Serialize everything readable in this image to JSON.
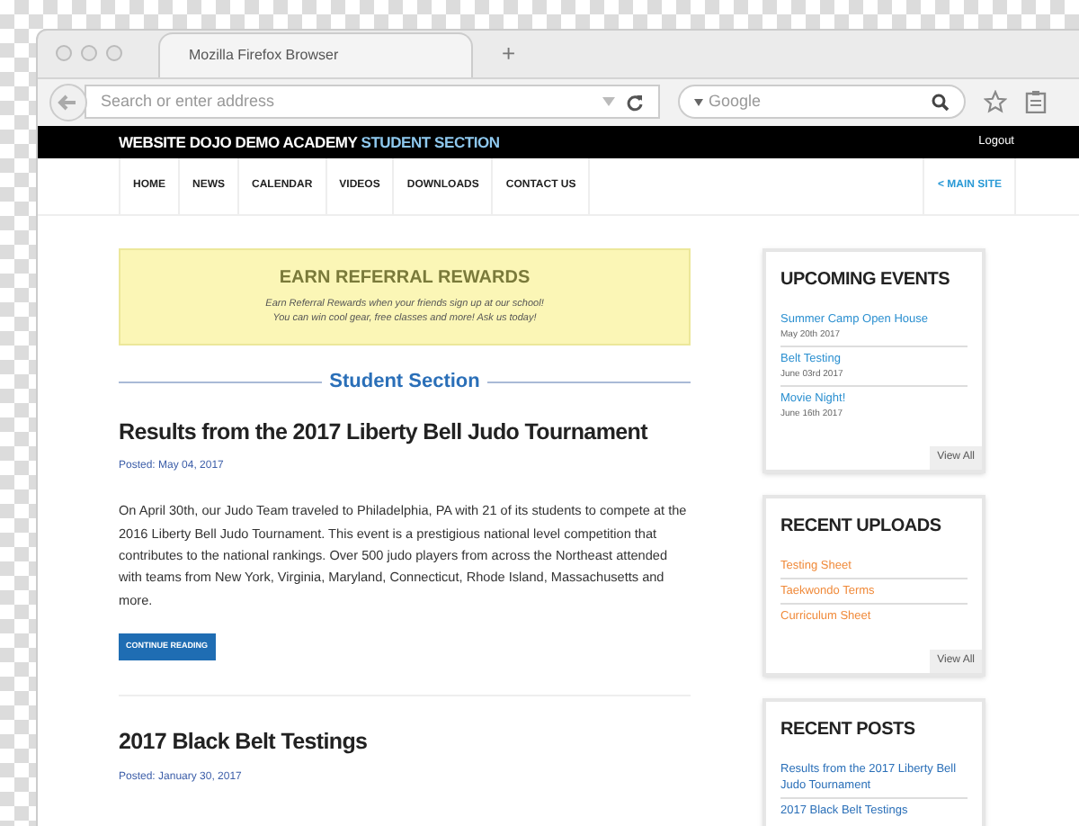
{
  "browser": {
    "tab_title": "Mozilla Firefox Browser",
    "new_tab": "+",
    "address_placeholder": "Search or enter address",
    "search_placeholder": "Google"
  },
  "site": {
    "brand": "WEBSITE DOJO DEMO ACADEMY",
    "brand_section": "STUDENT SECTION",
    "logout": "Logout",
    "nav": [
      "HOME",
      "NEWS",
      "CALENDAR",
      "VIDEOS",
      "DOWNLOADS",
      "CONTACT US"
    ],
    "main_site": "< MAIN SITE"
  },
  "banner": {
    "title": "EARN REFERRAL REWARDS",
    "lines": [
      "Earn Referral Rewards when your friends sign up at our school!",
      "You can win cool gear, free classes and more! Ask us today!"
    ]
  },
  "section_heading": "Student Section",
  "posts": [
    {
      "title": "Results from the 2017 Liberty Bell Judo Tournament",
      "posted": "Posted: May 04, 2017",
      "body": "On April 30th, our Judo Team traveled to Philadelphia, PA with 21 of its students to compete at the 2016 Liberty Bell Judo Tournament. This event is a prestigious national level competition that contributes to the national rankings. Over 500 judo players from across the Northeast attended with teams from New York, Virginia, Maryland, Connecticut, Rhode Island, Massachusetts and more.",
      "button": "CONTINUE READING"
    },
    {
      "title": "2017 Black Belt Testings",
      "posted": "Posted: January 30, 2017"
    }
  ],
  "sidebar": [
    {
      "kind": "events",
      "title": "UPCOMING EVENTS",
      "items": [
        {
          "title": "Summer Camp Open House",
          "date": "May 20th 2017"
        },
        {
          "title": "Belt Testing",
          "date": "June 03rd 2017"
        },
        {
          "title": "Movie Night!",
          "date": "June 16th 2017"
        }
      ],
      "view_all": "View All"
    },
    {
      "kind": "uploads",
      "title": "RECENT UPLOADS",
      "items": [
        {
          "title": "Testing Sheet"
        },
        {
          "title": "Taekwondo Terms"
        },
        {
          "title": "Curriculum Sheet"
        }
      ],
      "view_all": "View All"
    },
    {
      "kind": "posts",
      "title": "RECENT POSTS",
      "items": [
        {
          "title": "Results from the 2017 Liberty Bell Judo Tournament"
        },
        {
          "title": "2017 Black Belt Testings"
        }
      ]
    }
  ]
}
